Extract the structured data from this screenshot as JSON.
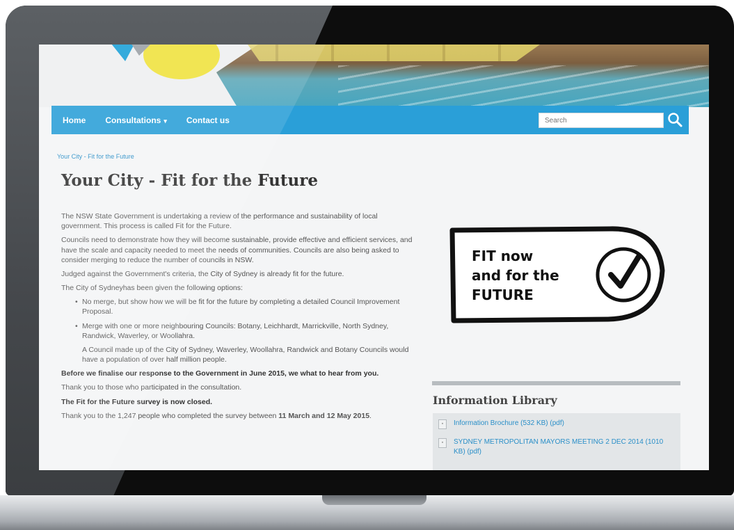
{
  "nav": {
    "home": "Home",
    "consultations": "Consultations",
    "consultations_caret": "▾",
    "contact": "Contact us",
    "search_placeholder": "Search"
  },
  "breadcrumb": "Your City - Fit for the Future",
  "page_title": "Your City - Fit for the Future",
  "article": {
    "p1": "The NSW State Government is undertaking a review of the performance and sustainability of local government. This process is called Fit for the Future.",
    "p2": "Councils need to demonstrate how they will become sustainable, provide effective and efficient services, and have the scale and capacity needed to meet the needs of communities. Councils are also being asked to consider merging to reduce the number of councils in NSW.",
    "p3": "Judged against the Government's criteria, the City of Sydney is already fit for the future.",
    "p4": "The City of Sydneyhas been given the following options:",
    "bullets": [
      "No merge, but show how we will be fit for the future by completing a detailed Council Improvement Proposal.",
      "Merge with one or more neighbouring Councils: Botany, Leichhardt, Marrickville, North Sydney, Randwick, Waverley, or Woollahra."
    ],
    "indent": "A Council made up of the City of Sydney, Waverley, Woollahra, Randwick and Botany Councils would have a population of over half million people.",
    "bold1": "Before we finalise our response to the Government in June 2015, we what to hear from you.",
    "p5": "Thank you to those who participated in the consultation.",
    "bold2": "The Fit for the Future survey is now closed.",
    "p6_start": "Thank you to the 1,247 people who completed the survey between ",
    "p6_bold1": "11 March and 12 May 2015",
    "p6_end": "."
  },
  "fit_logo": {
    "line1": "FIT now",
    "line2": "and for the",
    "line3": "FUTURE"
  },
  "info_library": {
    "title": "Information Library",
    "items": [
      "Information Brochure (532 KB) (pdf)",
      "SYDNEY METROPOLITAN MAYORS MEETING 2 DEC 2014 (1010 KB) (pdf)"
    ]
  },
  "colors": {
    "nav": "#2a9fd8",
    "link": "#2a8fc8",
    "frame": "#0d0d0d"
  },
  "icons": [
    "search-icon",
    "document-icon",
    "checkmark-icon"
  ]
}
